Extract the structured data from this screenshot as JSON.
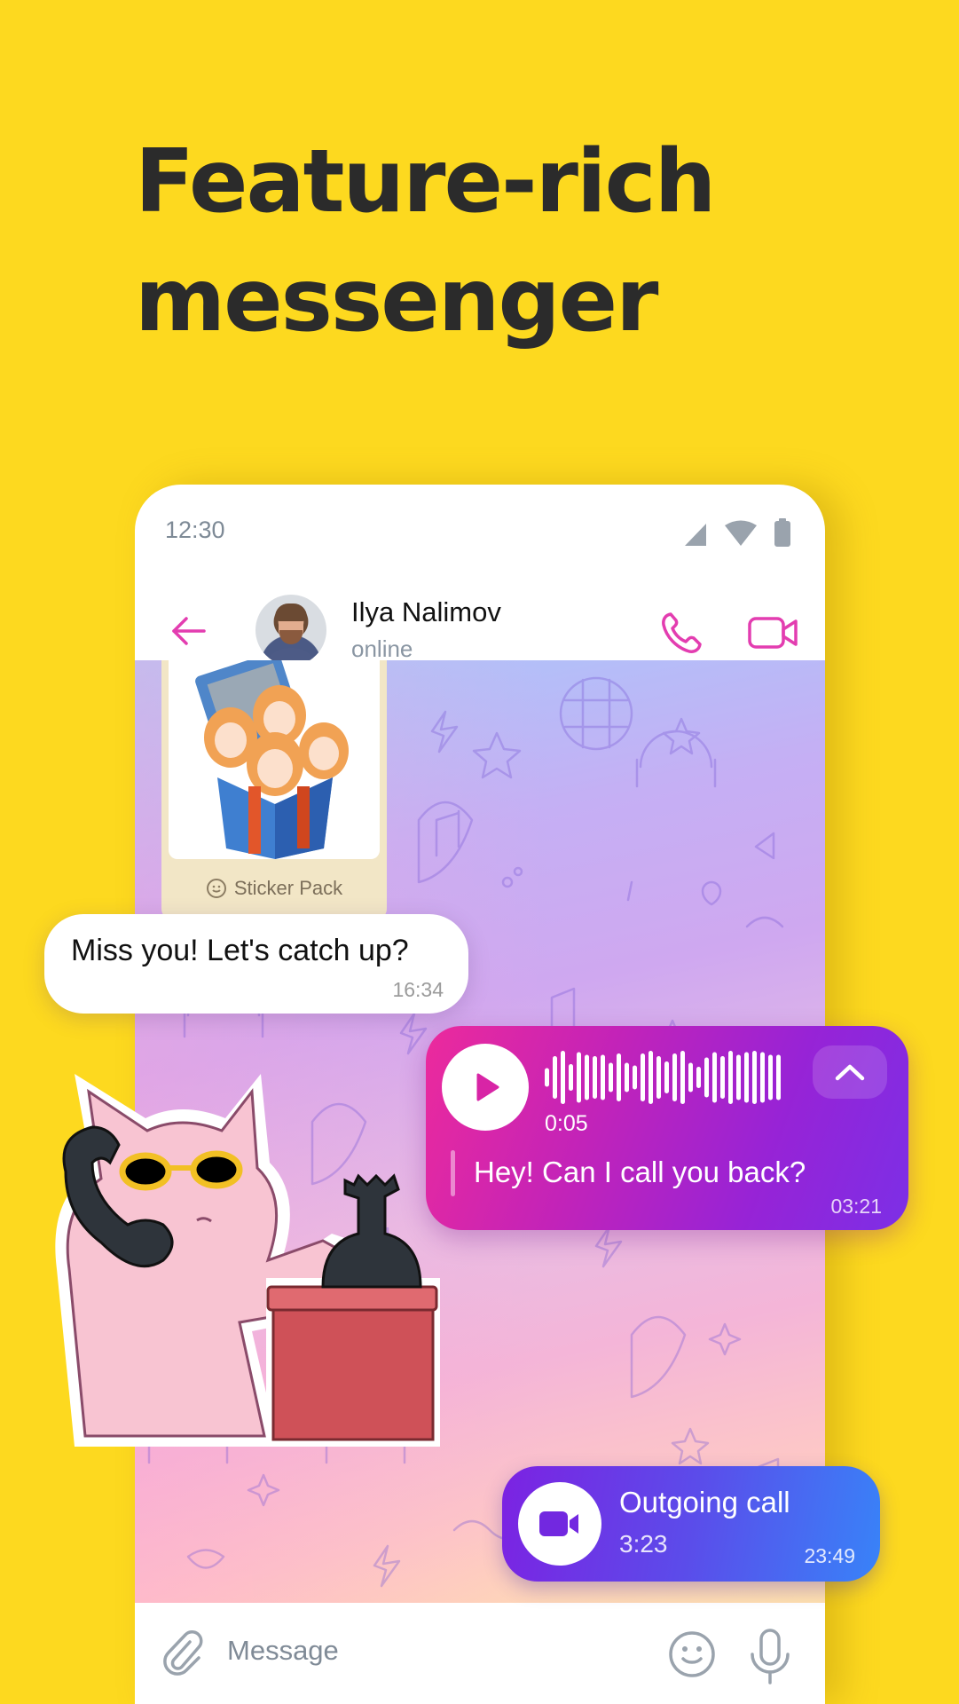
{
  "headline": {
    "line1": "Feature-rich",
    "line2": "messenger"
  },
  "colors": {
    "background": "#FDD91F",
    "headline": "#2B2B2B",
    "accent": "#E33DB0",
    "muted_icon": "#9AA3AD",
    "voice_gradient_start": "#EC2A9C",
    "voice_gradient_end": "#7C2FE6",
    "call_gradient_start": "#7C22E2",
    "call_gradient_end": "#3883F8"
  },
  "status_bar": {
    "time": "12:30",
    "icons": [
      "signal-icon",
      "wifi-icon",
      "battery-icon"
    ]
  },
  "chat_header": {
    "back_icon": "arrow-left-icon",
    "contact_name": "Ilya Nalimov",
    "contact_status": "online",
    "actions": [
      "phone-icon",
      "video-camera-icon"
    ]
  },
  "messages": {
    "sticker_pack": {
      "label": "Sticker Pack",
      "icon": "smiley-icon"
    },
    "incoming_text": {
      "text": "Miss you! Let's catch up?",
      "time": "16:34"
    },
    "voice_message": {
      "duration": "0:05",
      "transcript": "Hey! Can I call you back?",
      "time": "03:21",
      "waveform_levels": [
        0.35,
        0.8,
        1.0,
        0.5,
        0.95,
        0.85,
        0.8,
        0.85,
        0.55,
        0.9,
        0.55,
        0.45,
        0.9,
        1.0,
        0.8,
        0.6,
        0.9,
        1.0,
        0.55,
        0.4,
        0.75,
        0.95,
        0.8,
        1.0,
        0.85,
        0.95,
        1.0,
        0.95,
        0.85,
        0.85
      ]
    },
    "sticker_cat": {
      "description": "pink cat with sunglasses on phone"
    },
    "outgoing_call": {
      "title": "Outgoing call",
      "duration": "3:23",
      "time": "23:49"
    }
  },
  "composer": {
    "placeholder": "Message",
    "attach_icon": "paperclip-icon",
    "emoji_icon": "smiley-icon",
    "mic_icon": "microphone-icon"
  }
}
